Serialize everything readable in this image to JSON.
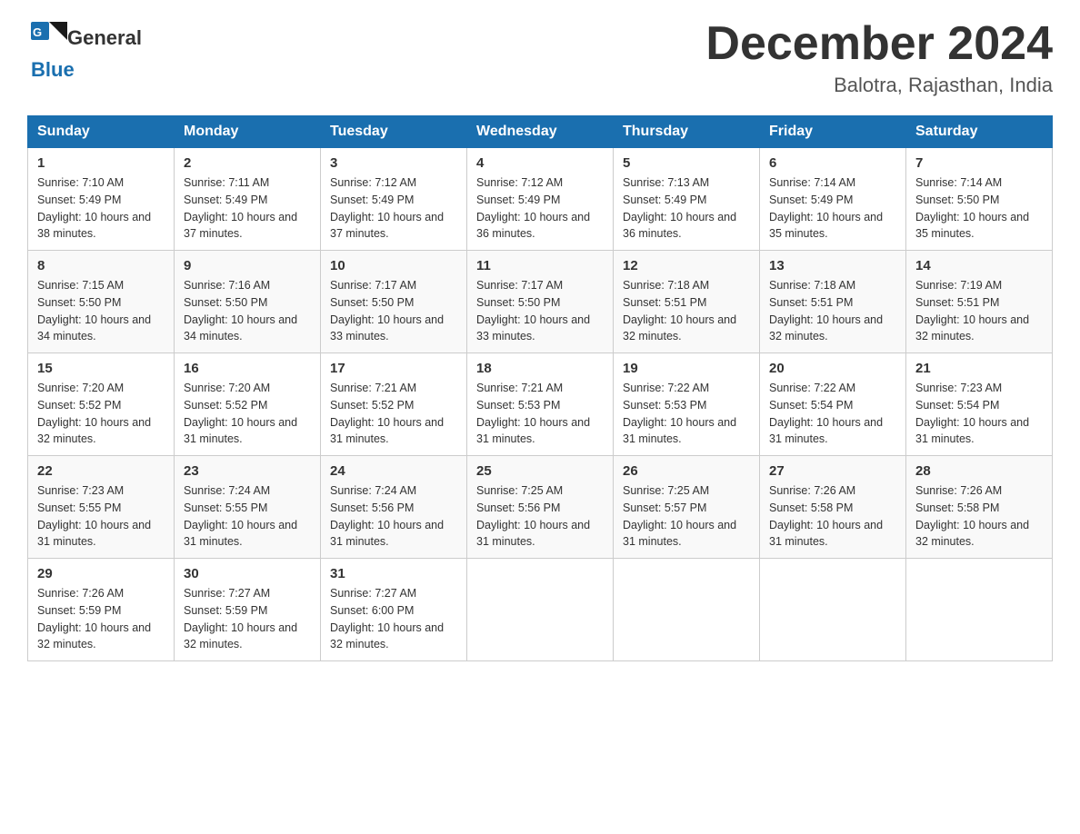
{
  "header": {
    "month_year": "December 2024",
    "location": "Balotra, Rajasthan, India",
    "logo_general": "General",
    "logo_blue": "Blue"
  },
  "days_of_week": [
    "Sunday",
    "Monday",
    "Tuesday",
    "Wednesday",
    "Thursday",
    "Friday",
    "Saturday"
  ],
  "weeks": [
    [
      {
        "day": "1",
        "sunrise": "7:10 AM",
        "sunset": "5:49 PM",
        "daylight": "10 hours and 38 minutes."
      },
      {
        "day": "2",
        "sunrise": "7:11 AM",
        "sunset": "5:49 PM",
        "daylight": "10 hours and 37 minutes."
      },
      {
        "day": "3",
        "sunrise": "7:12 AM",
        "sunset": "5:49 PM",
        "daylight": "10 hours and 37 minutes."
      },
      {
        "day": "4",
        "sunrise": "7:12 AM",
        "sunset": "5:49 PM",
        "daylight": "10 hours and 36 minutes."
      },
      {
        "day": "5",
        "sunrise": "7:13 AM",
        "sunset": "5:49 PM",
        "daylight": "10 hours and 36 minutes."
      },
      {
        "day": "6",
        "sunrise": "7:14 AM",
        "sunset": "5:49 PM",
        "daylight": "10 hours and 35 minutes."
      },
      {
        "day": "7",
        "sunrise": "7:14 AM",
        "sunset": "5:50 PM",
        "daylight": "10 hours and 35 minutes."
      }
    ],
    [
      {
        "day": "8",
        "sunrise": "7:15 AM",
        "sunset": "5:50 PM",
        "daylight": "10 hours and 34 minutes."
      },
      {
        "day": "9",
        "sunrise": "7:16 AM",
        "sunset": "5:50 PM",
        "daylight": "10 hours and 34 minutes."
      },
      {
        "day": "10",
        "sunrise": "7:17 AM",
        "sunset": "5:50 PM",
        "daylight": "10 hours and 33 minutes."
      },
      {
        "day": "11",
        "sunrise": "7:17 AM",
        "sunset": "5:50 PM",
        "daylight": "10 hours and 33 minutes."
      },
      {
        "day": "12",
        "sunrise": "7:18 AM",
        "sunset": "5:51 PM",
        "daylight": "10 hours and 32 minutes."
      },
      {
        "day": "13",
        "sunrise": "7:18 AM",
        "sunset": "5:51 PM",
        "daylight": "10 hours and 32 minutes."
      },
      {
        "day": "14",
        "sunrise": "7:19 AM",
        "sunset": "5:51 PM",
        "daylight": "10 hours and 32 minutes."
      }
    ],
    [
      {
        "day": "15",
        "sunrise": "7:20 AM",
        "sunset": "5:52 PM",
        "daylight": "10 hours and 32 minutes."
      },
      {
        "day": "16",
        "sunrise": "7:20 AM",
        "sunset": "5:52 PM",
        "daylight": "10 hours and 31 minutes."
      },
      {
        "day": "17",
        "sunrise": "7:21 AM",
        "sunset": "5:52 PM",
        "daylight": "10 hours and 31 minutes."
      },
      {
        "day": "18",
        "sunrise": "7:21 AM",
        "sunset": "5:53 PM",
        "daylight": "10 hours and 31 minutes."
      },
      {
        "day": "19",
        "sunrise": "7:22 AM",
        "sunset": "5:53 PM",
        "daylight": "10 hours and 31 minutes."
      },
      {
        "day": "20",
        "sunrise": "7:22 AM",
        "sunset": "5:54 PM",
        "daylight": "10 hours and 31 minutes."
      },
      {
        "day": "21",
        "sunrise": "7:23 AM",
        "sunset": "5:54 PM",
        "daylight": "10 hours and 31 minutes."
      }
    ],
    [
      {
        "day": "22",
        "sunrise": "7:23 AM",
        "sunset": "5:55 PM",
        "daylight": "10 hours and 31 minutes."
      },
      {
        "day": "23",
        "sunrise": "7:24 AM",
        "sunset": "5:55 PM",
        "daylight": "10 hours and 31 minutes."
      },
      {
        "day": "24",
        "sunrise": "7:24 AM",
        "sunset": "5:56 PM",
        "daylight": "10 hours and 31 minutes."
      },
      {
        "day": "25",
        "sunrise": "7:25 AM",
        "sunset": "5:56 PM",
        "daylight": "10 hours and 31 minutes."
      },
      {
        "day": "26",
        "sunrise": "7:25 AM",
        "sunset": "5:57 PM",
        "daylight": "10 hours and 31 minutes."
      },
      {
        "day": "27",
        "sunrise": "7:26 AM",
        "sunset": "5:58 PM",
        "daylight": "10 hours and 31 minutes."
      },
      {
        "day": "28",
        "sunrise": "7:26 AM",
        "sunset": "5:58 PM",
        "daylight": "10 hours and 32 minutes."
      }
    ],
    [
      {
        "day": "29",
        "sunrise": "7:26 AM",
        "sunset": "5:59 PM",
        "daylight": "10 hours and 32 minutes."
      },
      {
        "day": "30",
        "sunrise": "7:27 AM",
        "sunset": "5:59 PM",
        "daylight": "10 hours and 32 minutes."
      },
      {
        "day": "31",
        "sunrise": "7:27 AM",
        "sunset": "6:00 PM",
        "daylight": "10 hours and 32 minutes."
      },
      null,
      null,
      null,
      null
    ]
  ]
}
